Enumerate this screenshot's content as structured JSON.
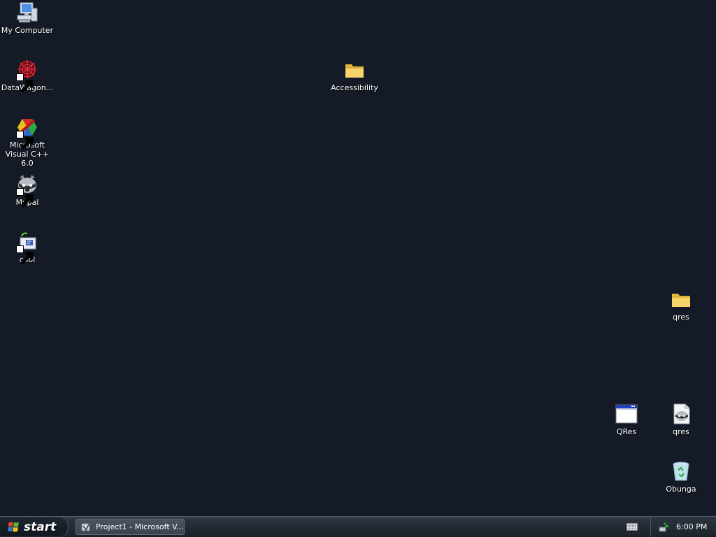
{
  "desktop": {
    "icons": [
      {
        "label": "My Computer",
        "icon": "my-computer-icon"
      },
      {
        "label": "DataWagon...",
        "icon": "datawagon-icon",
        "shortcut": true
      },
      {
        "label": "Microsoft Visual C++ 6.0",
        "icon": "visual-cpp-icon",
        "shortcut": true
      },
      {
        "label": "Mypal",
        "icon": "mypal-raccoon-icon",
        "shortcut": true
      },
      {
        "label": "cool",
        "icon": "cool-icon",
        "shortcut": true
      },
      {
        "label": "Accessibility",
        "icon": "folder-icon"
      },
      {
        "label": "qres",
        "icon": "folder-icon"
      },
      {
        "label": "QRes",
        "icon": "application-window-icon"
      },
      {
        "label": "qres",
        "icon": "raccoon-file-icon"
      },
      {
        "label": "Obunga",
        "icon": "recycle-bin-icon"
      }
    ]
  },
  "taskbar": {
    "start_label": "start",
    "task_button_label": "Project1 - Microsoft V...",
    "clock": "6:00 PM"
  }
}
